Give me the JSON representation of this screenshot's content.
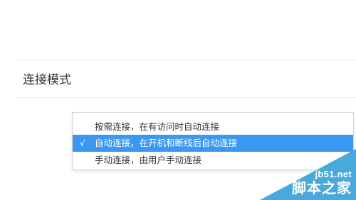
{
  "section": {
    "title": "连接模式"
  },
  "dropdown": {
    "options": [
      {
        "label": "按需连接，在有访问时自动连接",
        "selected": false,
        "check": ""
      },
      {
        "label": "自动连接，在开机和断线后自动连接",
        "selected": true,
        "check": "√"
      },
      {
        "label": "手动连接，由用户手动连接",
        "selected": false,
        "check": ""
      }
    ]
  },
  "watermark": {
    "domain": "jb51.net",
    "name": "脚本之家"
  },
  "colors": {
    "selected_bg": "#3a98f1",
    "watermark_bg": "#49a8dc"
  }
}
